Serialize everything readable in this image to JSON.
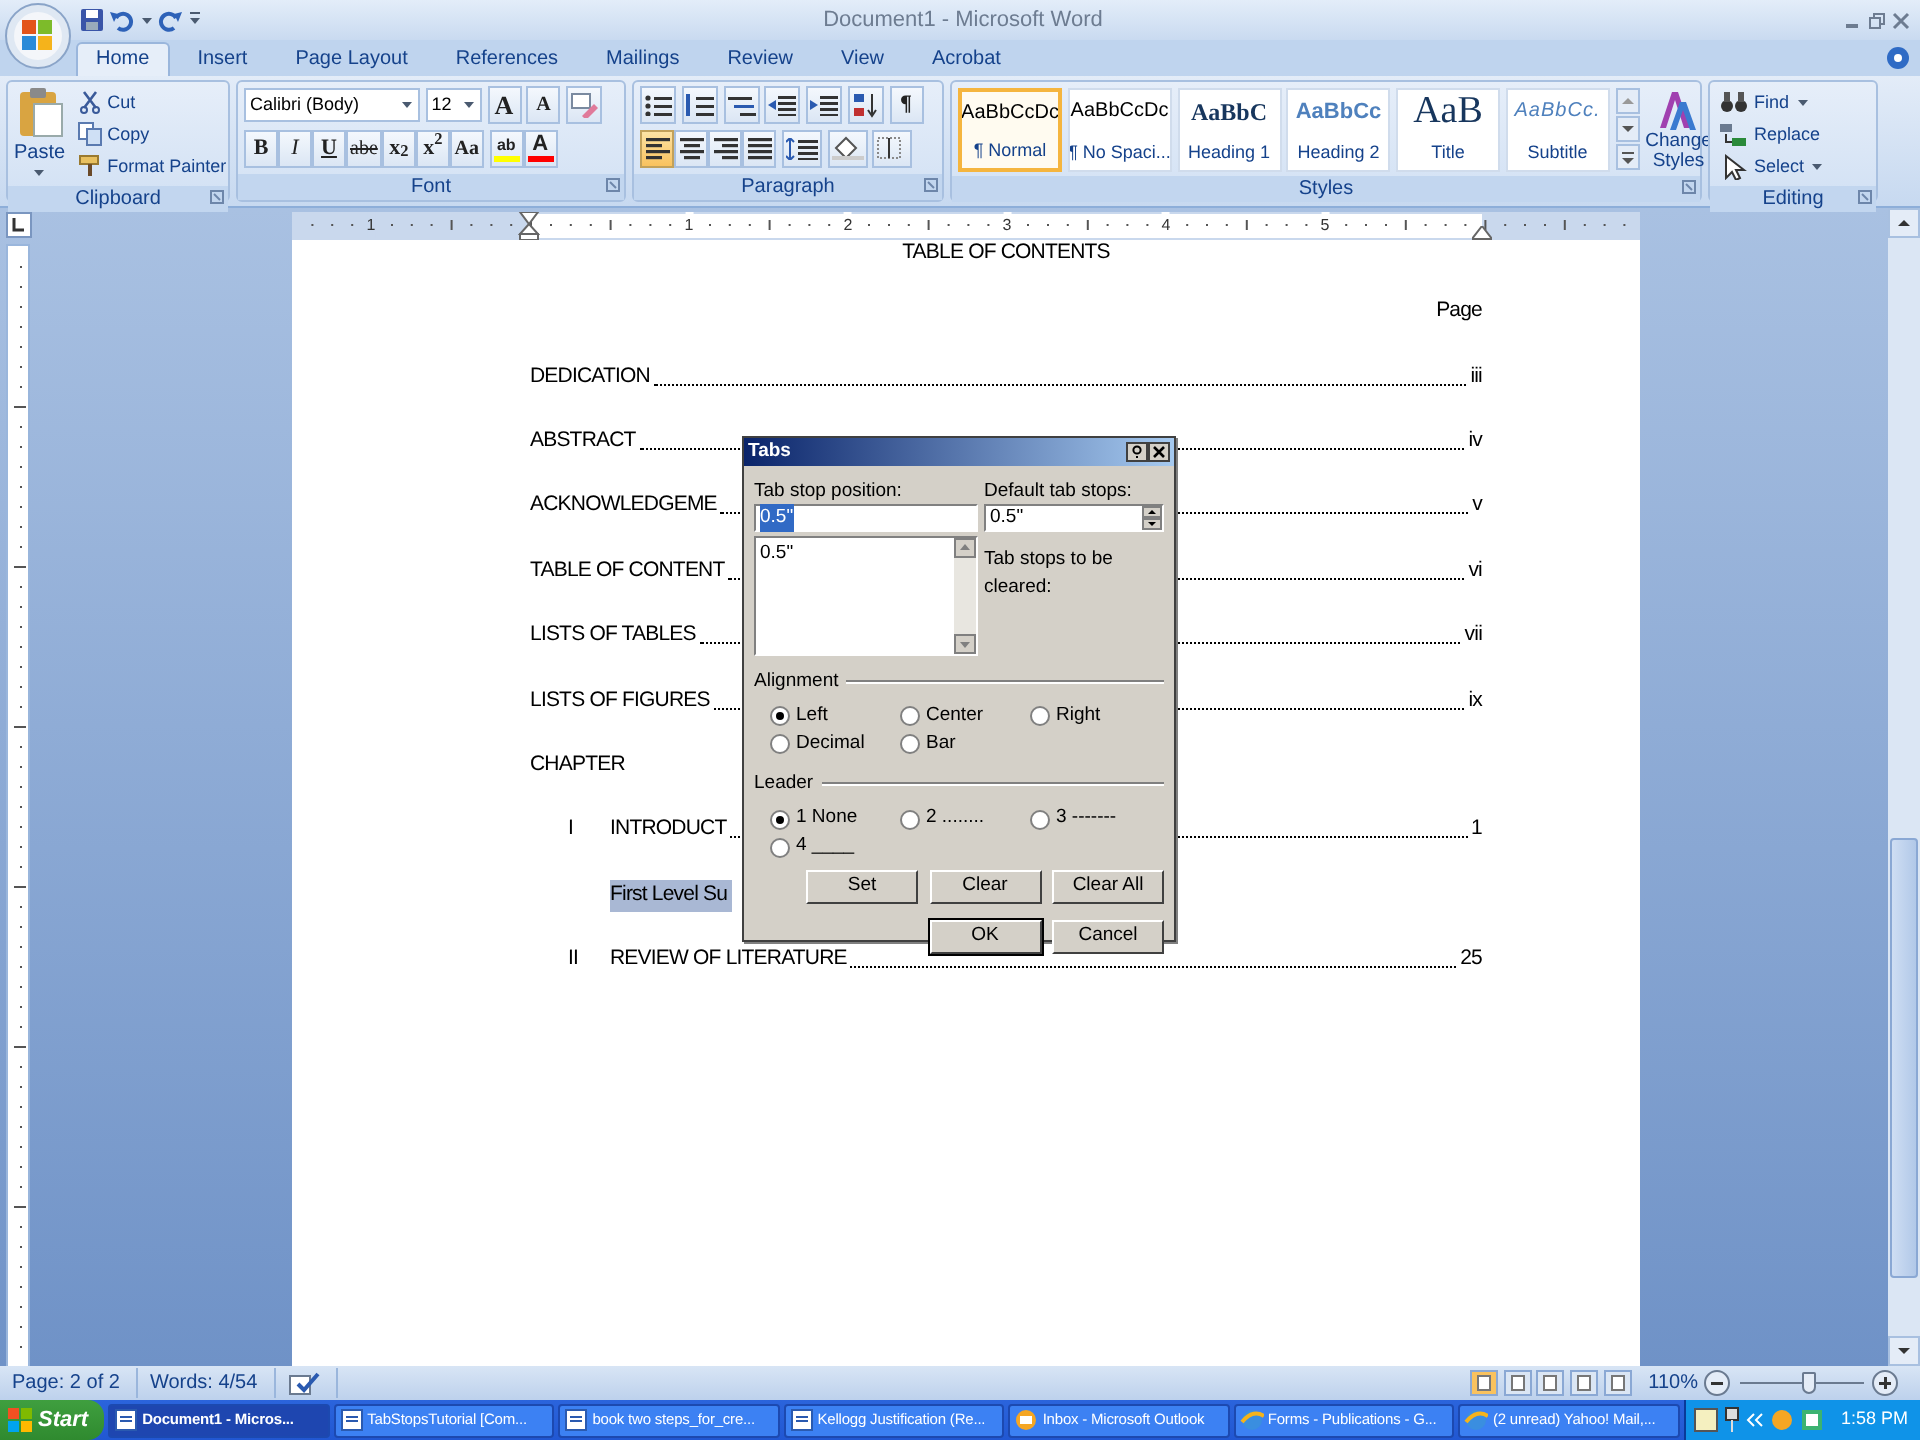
{
  "window": {
    "title": "Document1 - Microsoft Word"
  },
  "tabs": [
    {
      "label": "Home",
      "selected": true
    },
    {
      "label": "Insert",
      "selected": false
    },
    {
      "label": "Page Layout",
      "selected": false
    },
    {
      "label": "References",
      "selected": false
    },
    {
      "label": "Mailings",
      "selected": false
    },
    {
      "label": "Review",
      "selected": false
    },
    {
      "label": "View",
      "selected": false
    },
    {
      "label": "Acrobat",
      "selected": false
    }
  ],
  "ribbon": {
    "clipboard": {
      "title": "Clipboard",
      "paste": "Paste",
      "items": [
        {
          "kind": "cut",
          "label": "Cut"
        },
        {
          "kind": "copy",
          "label": "Copy"
        },
        {
          "kind": "painter",
          "label": "Format Painter"
        }
      ]
    },
    "font": {
      "title": "Font",
      "face": "Calibri (Body)",
      "size": "12",
      "size_buttons": [
        {
          "kind": "grow",
          "label": "A"
        },
        {
          "kind": "shrink",
          "label": "A"
        }
      ],
      "format_buttons": [
        {
          "kind": "bold",
          "label": "B"
        },
        {
          "kind": "italic",
          "label": "I"
        },
        {
          "kind": "underline",
          "label": "U"
        },
        {
          "kind": "strike",
          "label": "abe"
        },
        {
          "kind": "sub",
          "label": "x$_{2}$"
        },
        {
          "kind": "sup",
          "label": "x$^{2}$"
        },
        {
          "kind": "case",
          "label": "Aa"
        }
      ],
      "color_buttons": [
        {
          "label": "ab",
          "color": "#ffff00"
        },
        {
          "label": "A",
          "color": "#ff0000"
        }
      ]
    },
    "paragraph": {
      "title": "Paragraph",
      "marks_button": "¶",
      "align_buttons": [
        {
          "kind": "left",
          "selected": true
        },
        {
          "kind": "center",
          "selected": false
        },
        {
          "kind": "right",
          "selected": false
        },
        {
          "kind": "justify",
          "selected": false
        }
      ]
    },
    "styles": {
      "title": "Styles",
      "change": "Change Styles",
      "gallery": [
        {
          "kind": "normal",
          "sample": "AaBbCcDc",
          "label": "¶ Normal",
          "selected": true
        },
        {
          "kind": "nospacing",
          "sample": "AaBbCcDc",
          "label": "¶ No Spaci...",
          "selected": false
        },
        {
          "kind": "heading1",
          "sample": "AaBbC",
          "label": "Heading 1",
          "selected": false
        },
        {
          "kind": "heading2",
          "sample": "AaBbCc",
          "label": "Heading 2",
          "selected": false
        },
        {
          "kind": "title",
          "sample": "AaB",
          "label": "Title",
          "selected": false
        },
        {
          "kind": "subtitle",
          "sample": "AaBbCc.",
          "label": "Subtitle",
          "selected": false
        }
      ]
    },
    "editing": {
      "title": "Editing",
      "items": [
        {
          "kind": "find",
          "label": "Find"
        },
        {
          "kind": "replace",
          "label": "Replace"
        },
        {
          "kind": "select",
          "label": "Select"
        }
      ]
    }
  },
  "ruler": {
    "labels": [
      "1",
      "1",
      "2",
      "3",
      "4",
      "5"
    ]
  },
  "document": {
    "heading": "TABLE OF CONTENTS",
    "page_label": "Page",
    "entries": [
      {
        "kind": "entry",
        "label": "DEDICATION",
        "page": "iii"
      },
      {
        "kind": "entry",
        "label": "ABSTRACT",
        "page": "iv"
      },
      {
        "kind": "entry",
        "label": "ACKNOWLEDGEME",
        "page": "v"
      },
      {
        "kind": "entry",
        "label": "TABLE OF CONTENT",
        "page": "vi"
      },
      {
        "kind": "entry",
        "label": "LISTS OF TABLES",
        "page": "vii"
      },
      {
        "kind": "entry",
        "label": "LISTS OF FIGURES",
        "page": "ix"
      },
      {
        "kind": "heading",
        "label": "CHAPTER"
      },
      {
        "kind": "numbered",
        "number": "I",
        "label": "INTRODUCT",
        "page": "1"
      },
      {
        "kind": "highlighted",
        "label": "First Level Su"
      },
      {
        "kind": "numbered",
        "number": "II",
        "label": "REVIEW OF LITERATURE",
        "page": "25"
      }
    ]
  },
  "dialog": {
    "title": "Tabs",
    "tab_stop_label": "Tab stop position:",
    "tab_stop_value": "0.5\"",
    "tab_stops": [
      "0.5\""
    ],
    "default_label": "Default tab stops:",
    "default_value": "0.5\"",
    "cleared_label": "Tab stops to be cleared:",
    "alignment_title": "Alignment",
    "alignment": [
      {
        "label": "Left",
        "selected": true
      },
      {
        "label": "Center",
        "selected": false
      },
      {
        "label": "Right",
        "selected": false
      },
      {
        "label": "Decimal",
        "selected": false
      },
      {
        "label": "Bar",
        "selected": false
      }
    ],
    "leader_title": "Leader",
    "leader": [
      {
        "label": "1 None",
        "selected": true
      },
      {
        "label": "2 ........",
        "selected": false
      },
      {
        "label": "3 -------",
        "selected": false
      },
      {
        "label": "4 ____",
        "selected": false
      }
    ],
    "buttons": [
      "Set",
      "Clear",
      "Clear All"
    ],
    "footer_buttons": [
      "OK",
      "Cancel"
    ]
  },
  "status_bar": {
    "page": "Page: 2 of 2",
    "words": "Words: 4/54",
    "zoom": "110%",
    "zoom_slider": {
      "level": 0.55
    }
  },
  "taskbar": {
    "start": "Start",
    "tasks": [
      {
        "kind": "word",
        "label": "Document1 - Micros...",
        "selected": true
      },
      {
        "kind": "word",
        "label": "TabStopsTutorial [Com...",
        "selected": false
      },
      {
        "kind": "word",
        "label": "book two steps_for_cre...",
        "selected": false
      },
      {
        "kind": "word",
        "label": "Kellogg Justification (Re...",
        "selected": false
      },
      {
        "kind": "outlook",
        "label": "Inbox - Microsoft Outlook",
        "selected": false
      },
      {
        "kind": "browser",
        "label": "Forms - Publications - G...",
        "selected": false
      },
      {
        "kind": "browser",
        "label": "(2 unread) Yahoo! Mail,...",
        "selected": false
      }
    ],
    "clock": "1:58 PM"
  }
}
